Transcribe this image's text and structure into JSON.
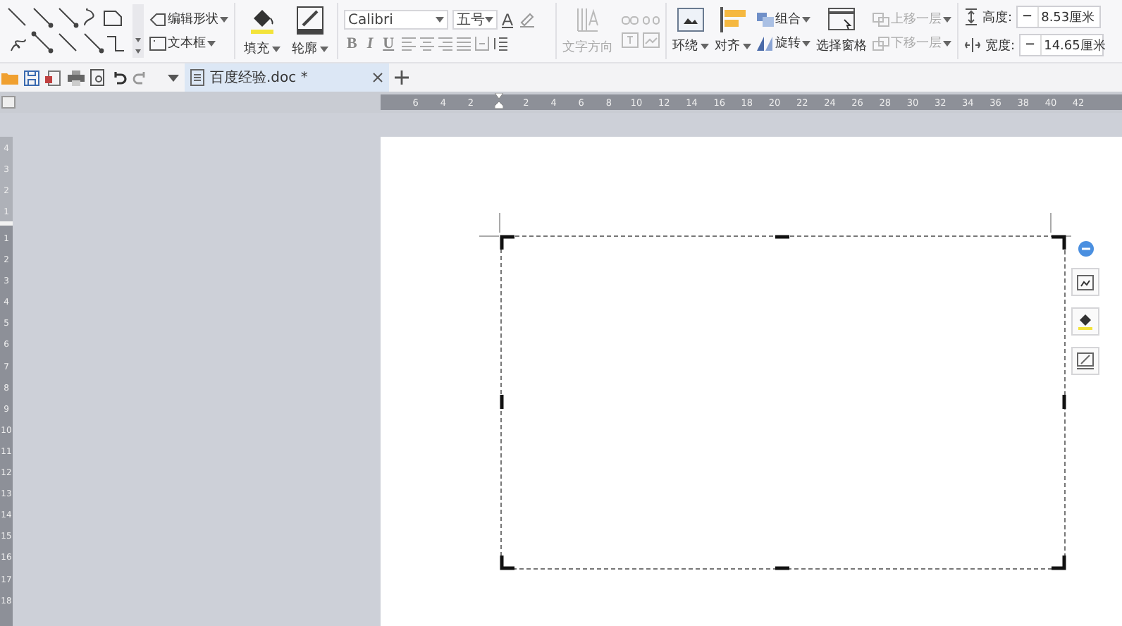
{
  "ribbon": {
    "edit_shape": "编辑形状",
    "text_box": "文本框",
    "fill": "填充",
    "outline": "轮廓",
    "font": {
      "name": "Calibri",
      "size": "五号",
      "color_button": "A"
    },
    "format_buttons": [
      "B",
      "I",
      "U"
    ],
    "text_direction": {
      "label": "文字方向",
      "disabled": true
    },
    "arrange": [
      {
        "label": "环绕",
        "disabled": false
      },
      {
        "label": "对齐",
        "disabled": false
      },
      {
        "label": "组合",
        "disabled": false
      },
      {
        "label": "旋转",
        "disabled": false
      },
      {
        "label": "选择窗格",
        "disabled": false
      },
      {
        "label": "上移一层",
        "disabled": true
      },
      {
        "label": "下移一层",
        "disabled": true
      }
    ],
    "size": [
      {
        "label": "高度:",
        "decrement": "−",
        "value": "8.53厘米"
      },
      {
        "label": "宽度:",
        "decrement": "−",
        "value": "14.65厘米"
      }
    ]
  },
  "tabs": [
    {
      "label": "百度经验.doc *",
      "selected": true
    }
  ],
  "ruler": {
    "left_labels": [
      "6",
      "4",
      "2"
    ],
    "right_labels": [
      "2",
      "4",
      "6",
      "8",
      "10",
      "12",
      "14",
      "16",
      "18",
      "20",
      "22",
      "24",
      "26",
      "28",
      "30",
      "32",
      "34",
      "36",
      "38",
      "40",
      "42"
    ]
  },
  "vertical_ruler": {
    "top_labels": [
      "4",
      "3",
      "2",
      "1"
    ],
    "bottom_labels": [
      "1",
      "2",
      "3",
      "4",
      "5",
      "6",
      "7",
      "8",
      "9",
      "10",
      "11",
      "12",
      "13",
      "14",
      "15",
      "16",
      "17",
      "18"
    ]
  }
}
